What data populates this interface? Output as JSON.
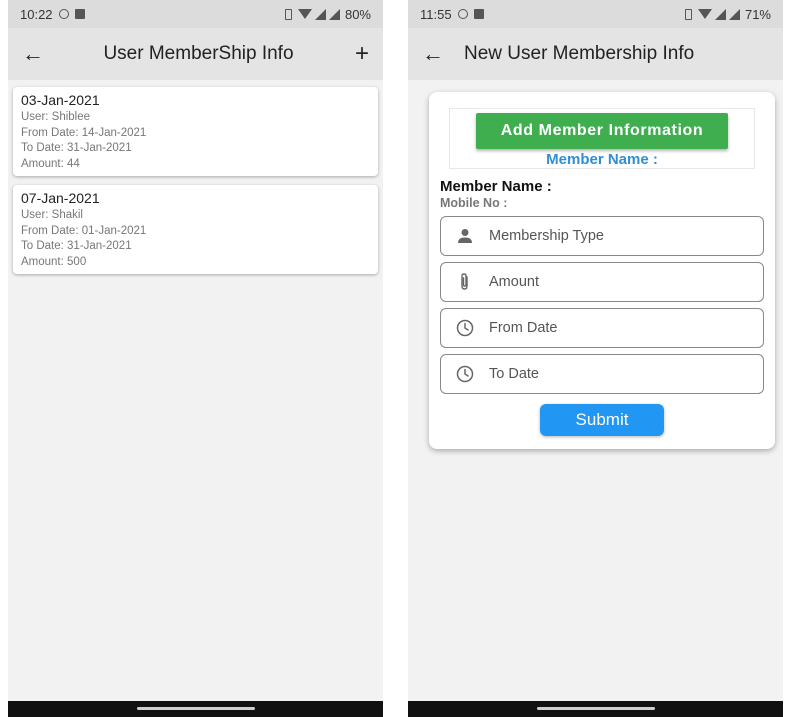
{
  "left": {
    "status": {
      "time": "10:22",
      "battery": "80%"
    },
    "appbar": {
      "back": "←",
      "title": "User MemberShip Info",
      "add": "+"
    },
    "records": [
      {
        "date": "03-Jan-2021",
        "user": "User: Shiblee",
        "from": "From Date: 14-Jan-2021",
        "to": "To Date: 31-Jan-2021",
        "amount": "Amount: 44"
      },
      {
        "date": "07-Jan-2021",
        "user": "User: Shakil",
        "from": "From Date: 01-Jan-2021",
        "to": "To Date: 31-Jan-2021",
        "amount": "Amount: 500"
      }
    ]
  },
  "right": {
    "status": {
      "time": "11:55",
      "battery": "71%"
    },
    "appbar": {
      "back": "←",
      "title": "New User Membership Info"
    },
    "form": {
      "add_button": "Add Member Information",
      "header_member_name": "Member Name :",
      "member_name_label": "Member Name :",
      "mobile_label": "Mobile No :",
      "fields": [
        {
          "label": "Membership Type",
          "icon": "person-icon"
        },
        {
          "label": "Amount",
          "icon": "paperclip-icon"
        },
        {
          "label": "From Date",
          "icon": "clock-icon"
        },
        {
          "label": "To Date",
          "icon": "clock-icon"
        }
      ],
      "submit": "Submit"
    }
  },
  "colors": {
    "add_button": "#3fae4f",
    "member_name_blue": "#2e8fd6",
    "submit": "#2196f3",
    "appbar": "#e4e4e4"
  }
}
